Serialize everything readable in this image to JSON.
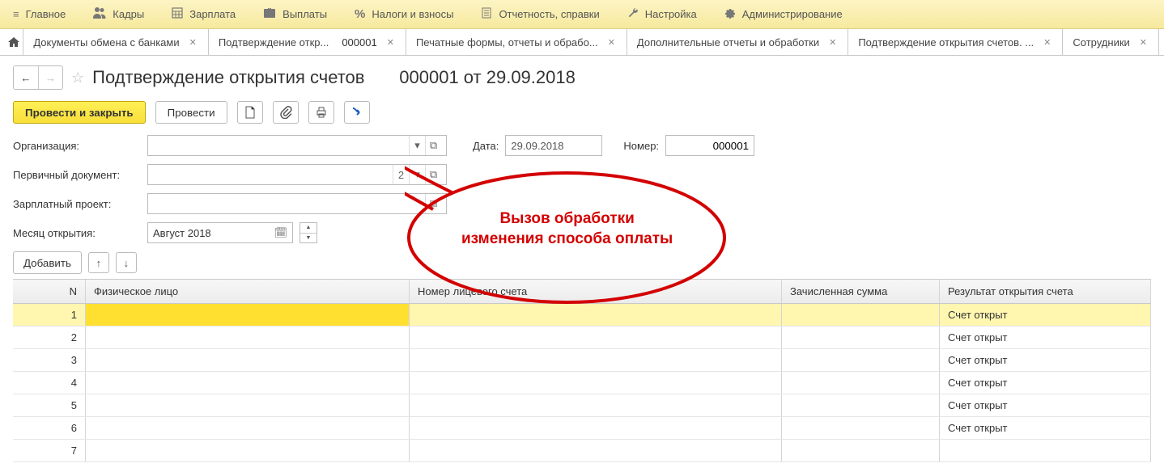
{
  "menu": {
    "items": [
      {
        "icon": "≡",
        "label": "Главное"
      },
      {
        "icon": "👥",
        "label": "Кадры"
      },
      {
        "icon": "🧮",
        "label": "Зарплата"
      },
      {
        "icon": "💼",
        "label": "Выплаты"
      },
      {
        "icon": "%",
        "label": "Налоги и взносы"
      },
      {
        "icon": "🗎",
        "label": "Отчетность, справки"
      },
      {
        "icon": "🔧",
        "label": "Настройка"
      },
      {
        "icon": "⚙",
        "label": "Администрирование"
      }
    ]
  },
  "tabs": {
    "items": [
      {
        "label": "Документы обмена с банками",
        "closable": true,
        "active": false
      },
      {
        "label": "Подтверждение откр...",
        "number": "000001",
        "closable": true,
        "active": true
      },
      {
        "label": "Печатные формы, отчеты и обрабо...",
        "closable": true,
        "active": false
      },
      {
        "label": "Дополнительные отчеты и обработки",
        "closable": true,
        "active": false
      },
      {
        "label": "Подтверждение открытия счетов. ...",
        "closable": true,
        "active": false
      },
      {
        "label": "Сотрудники",
        "closable": true,
        "active": false
      }
    ]
  },
  "page": {
    "title_main": "Подтверждение открытия счетов",
    "title_suffix": "000001 от 29.09.2018"
  },
  "actions": {
    "primary": "Провести и закрыть",
    "secondary": "Провести"
  },
  "form": {
    "org_label": "Организация:",
    "org_value": "",
    "date_label": "Дата:",
    "date_value": "29.09.2018",
    "number_label": "Номер:",
    "number_value": "000001",
    "doc_label": "Первичный документ:",
    "doc_value": "",
    "doc_end": "2",
    "proj_label": "Зарплатный проект:",
    "proj_value": "",
    "month_label": "Месяц открытия:",
    "month_value": "Август 2018",
    "add_label": "Добавить"
  },
  "table": {
    "headers": {
      "n": "N",
      "person": "Физическое лицо",
      "account": "Номер лицевого счета",
      "sum": "Зачисленная сумма",
      "result": "Результат открытия счета"
    },
    "rows": [
      {
        "n": "1",
        "person": "",
        "account": "",
        "sum": "",
        "result": "Счет открыт",
        "selected": true
      },
      {
        "n": "2",
        "person": "",
        "account": "",
        "sum": "",
        "result": "Счет открыт"
      },
      {
        "n": "3",
        "person": "",
        "account": "",
        "sum": "",
        "result": "Счет открыт"
      },
      {
        "n": "4",
        "person": "",
        "account": "",
        "sum": "",
        "result": "Счет открыт"
      },
      {
        "n": "5",
        "person": "",
        "account": "",
        "sum": "",
        "result": "Счет открыт"
      },
      {
        "n": "6",
        "person": "",
        "account": "",
        "sum": "",
        "result": "Счет открыт"
      },
      {
        "n": "7",
        "person": "",
        "account": "",
        "sum": "",
        "result": ""
      }
    ]
  },
  "callout": {
    "line1": "Вызов обработки",
    "line2": "изменения способа оплаты"
  }
}
